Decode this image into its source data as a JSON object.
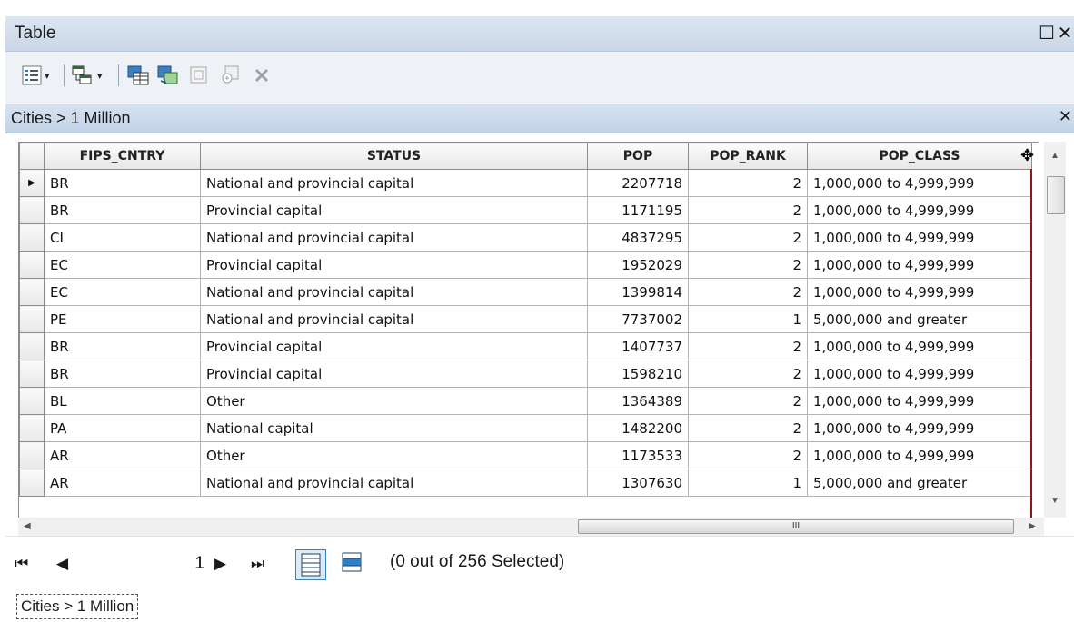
{
  "window": {
    "title": "Table",
    "restore_glyph": "☐",
    "close_glyph": "✕"
  },
  "toolbar": {
    "icons": [
      "table-options-icon",
      "related-tables-icon",
      "select-by-attributes-icon",
      "switch-selection-icon",
      "clear-selection-icon",
      "zoom-to-selected-icon",
      "delete-selected-icon"
    ],
    "dropdown_glyph": "▾"
  },
  "subtable": {
    "label": "Cities > 1 Million",
    "close_glyph": "✕"
  },
  "table": {
    "columns": [
      "FIPS_CNTRY",
      "STATUS",
      "POP",
      "POP_RANK",
      "POP_CLASS"
    ],
    "current_row_marker": "▶",
    "rows": [
      {
        "fips": "BR",
        "status": "National and provincial capital",
        "pop": "2207718",
        "rank": "2",
        "class": "1,000,000 to 4,999,999"
      },
      {
        "fips": "BR",
        "status": "Provincial capital",
        "pop": "1171195",
        "rank": "2",
        "class": "1,000,000 to 4,999,999"
      },
      {
        "fips": "CI",
        "status": "National and provincial capital",
        "pop": "4837295",
        "rank": "2",
        "class": "1,000,000 to 4,999,999"
      },
      {
        "fips": "EC",
        "status": "Provincial capital",
        "pop": "1952029",
        "rank": "2",
        "class": "1,000,000 to 4,999,999"
      },
      {
        "fips": "EC",
        "status": "National and provincial capital",
        "pop": "1399814",
        "rank": "2",
        "class": "1,000,000 to 4,999,999"
      },
      {
        "fips": "PE",
        "status": "National and provincial capital",
        "pop": "7737002",
        "rank": "1",
        "class": "5,000,000 and greater"
      },
      {
        "fips": "BR",
        "status": "Provincial capital",
        "pop": "1407737",
        "rank": "2",
        "class": "1,000,000 to 4,999,999"
      },
      {
        "fips": "BR",
        "status": "Provincial capital",
        "pop": "1598210",
        "rank": "2",
        "class": "1,000,000 to 4,999,999"
      },
      {
        "fips": "BL",
        "status": "Other",
        "pop": "1364389",
        "rank": "2",
        "class": "1,000,000 to 4,999,999"
      },
      {
        "fips": "PA",
        "status": "National capital",
        "pop": "1482200",
        "rank": "2",
        "class": "1,000,000 to 4,999,999"
      },
      {
        "fips": "AR",
        "status": "Other",
        "pop": "1173533",
        "rank": "2",
        "class": "1,000,000 to 4,999,999"
      },
      {
        "fips": "AR",
        "status": "National and provincial capital",
        "pop": "1307630",
        "rank": "1",
        "class": "5,000,000 and greater"
      }
    ]
  },
  "scroll": {
    "h_thumb_grip": "III",
    "up": "▲",
    "down": "▼",
    "left": "◀",
    "right": "▶"
  },
  "navigation": {
    "first": "⏮",
    "prev": "◀",
    "current_record": "1",
    "next": "▶",
    "last": "⏭",
    "selection_text": "(0 out of 256 Selected)"
  },
  "tab": {
    "label": "Cities > 1 Million"
  }
}
